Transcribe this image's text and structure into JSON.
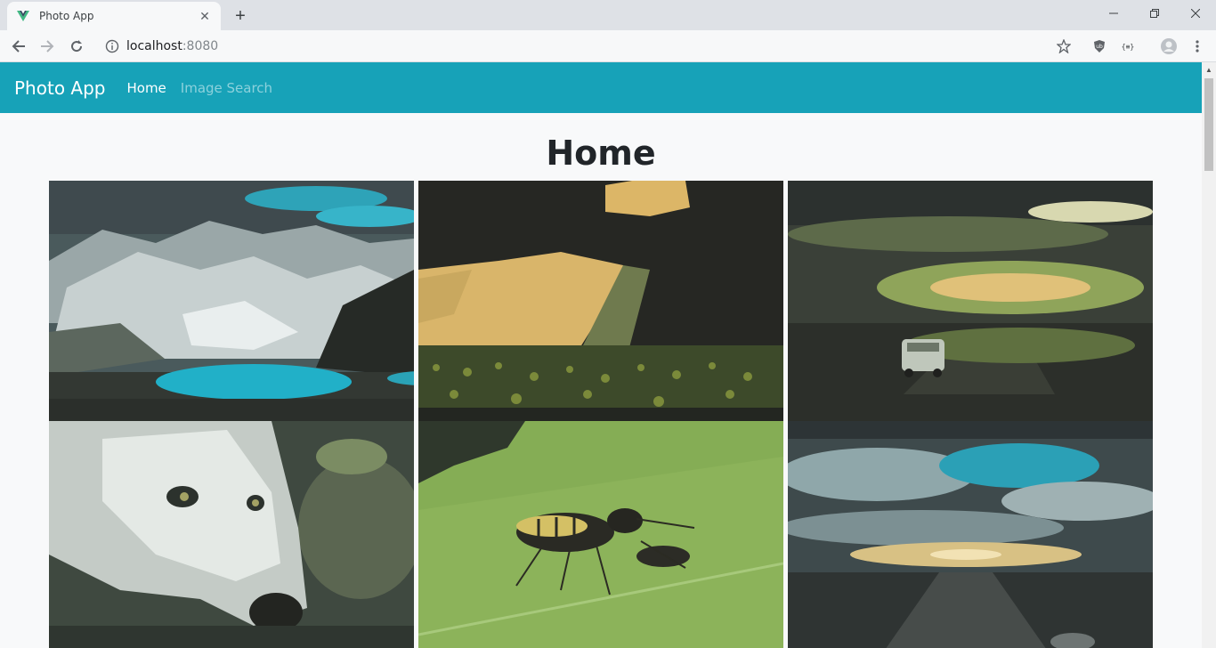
{
  "browser": {
    "tab_title": "Photo App",
    "tab_close_icon": "close-icon",
    "new_tab_label": "+",
    "url_host": "localhost",
    "url_port": ":8080"
  },
  "app": {
    "brand": "Photo App",
    "nav": [
      {
        "label": "Home",
        "active": true
      },
      {
        "label": "Image Search",
        "active": false
      }
    ],
    "heading": "Home",
    "accent_color": "#17a2b8",
    "photos": [
      {
        "subject": "glacier-lake-mountains"
      },
      {
        "subject": "storm-sunbeam-field"
      },
      {
        "subject": "car-on-road-sunset"
      },
      {
        "subject": "white-wolf"
      },
      {
        "subject": "wasp-on-leaf"
      },
      {
        "subject": "dramatic-sky-road"
      }
    ]
  }
}
